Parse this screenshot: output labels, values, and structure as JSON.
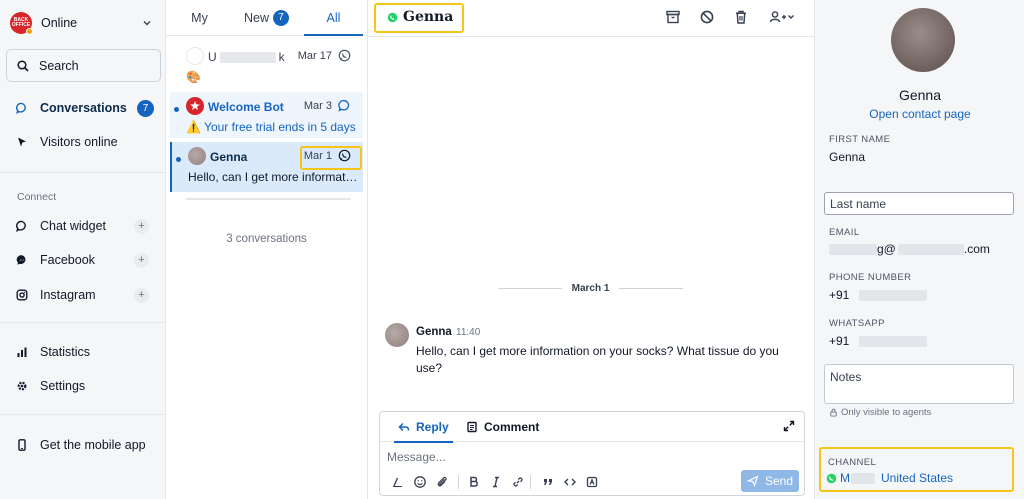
{
  "sidebar": {
    "logo_text": "BACK OFFICE",
    "status": "Online",
    "search_label": "Search",
    "nav": {
      "conversations": {
        "label": "Conversations",
        "badge": "7"
      },
      "visitors": {
        "label": "Visitors online"
      }
    },
    "connect_label": "Connect",
    "connect_items": [
      {
        "label": "Chat widget",
        "action": "+"
      },
      {
        "label": "Facebook",
        "action": "+"
      },
      {
        "label": "Instagram",
        "action": "+"
      }
    ],
    "statistics_label": "Statistics",
    "settings_label": "Settings",
    "mobile_label": "Get the mobile app"
  },
  "convlist": {
    "tabs": [
      {
        "label": "My"
      },
      {
        "label": "New",
        "badge": "7"
      },
      {
        "label": "All",
        "active": true
      }
    ],
    "items": [
      {
        "name_start": "U",
        "name_end": "k",
        "date": "Mar 17",
        "preview": "🎨",
        "unread": false
      },
      {
        "name": "Welcome Bot",
        "date": "Mar 3",
        "preview": "⚠️ Your free trial ends in 5 days",
        "unread": true
      },
      {
        "name": "Genna",
        "date": "Mar 1",
        "preview": "Hello, can I get more information on your socks?",
        "unread": true,
        "selected": true
      }
    ],
    "count_text": "3 conversations"
  },
  "chat": {
    "title": "Genna",
    "date_separator": "March 1",
    "message": {
      "author": "Genna",
      "time": "11:40",
      "text": "Hello, can I get more information on your socks? What tissue do you use?"
    },
    "composer": {
      "reply_label": "Reply",
      "comment_label": "Comment",
      "placeholder": "Message...",
      "send_label": "Send"
    }
  },
  "panel": {
    "contact_name": "Genna",
    "open_contact_link": "Open contact page",
    "first_name_label": "FIRST NAME",
    "first_name_value": "Genna",
    "last_name_placeholder": "Last name",
    "email_label": "EMAIL",
    "email_mid": "g@",
    "email_end": ".com",
    "phone_label": "PHONE NUMBER",
    "phone_prefix": "+91",
    "whatsapp_label": "WHATSAPP",
    "whatsapp_prefix": "+91",
    "notes_placeholder": "Notes",
    "private_note": "Only visible to agents",
    "channel_label": "CHANNEL",
    "channel_name_start": "M",
    "channel_country": "United States"
  },
  "colors": {
    "accent": "#1565c0",
    "highlight": "#f5c518",
    "whatsapp": "#25d366",
    "selected_row": "#dbeafb"
  },
  "icons": [
    "search-icon",
    "chat-bubble-icon",
    "cursor-icon",
    "messenger-icon",
    "instagram-icon",
    "bar-chart-icon",
    "gear-icon",
    "mobile-phone-icon",
    "whatsapp-icon",
    "archive-icon",
    "block-icon",
    "trash-icon",
    "add-user-icon",
    "reply-icon",
    "comment-icon",
    "expand-icon",
    "send-icon",
    "lock-icon"
  ]
}
